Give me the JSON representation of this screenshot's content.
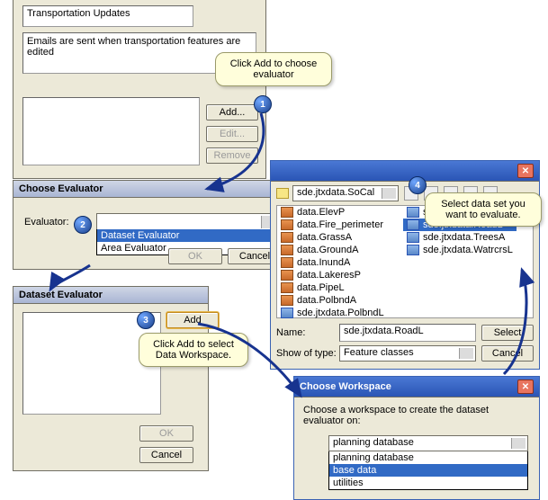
{
  "top": {
    "title": "Transportation Updates",
    "note": "Emails are sent when transportation features are edited",
    "add": "Add...",
    "edit": "Edit...",
    "remove": "Remove"
  },
  "chooseEval": {
    "title": "Choose Evaluator",
    "label": "Evaluator:",
    "options": [
      "Dataset Evaluator",
      "Area Evaluator"
    ],
    "ok": "OK",
    "cancel": "Cancel"
  },
  "dsEval": {
    "title": "Dataset Evaluator",
    "add": "Add",
    "ok": "OK",
    "cancel": "Cancel"
  },
  "browser": {
    "path": "sde.jtxdata.SoCal",
    "left": [
      "data.ElevP",
      "data.Fire_perimeter",
      "data.GrassA",
      "data.GroundA",
      "data.InundA",
      "data.LakeresP",
      "data.PipeL",
      "data.PolbndA",
      "sde.jtxdata.PolbndL"
    ],
    "right": [
      "sde.jtxdata.RailrdL",
      "sde.jtxdata.RoadL",
      "sde.jtxdata.TreesA",
      "sde.jtxdata.WatrcrsL"
    ],
    "nameLbl": "Name:",
    "nameVal": "sde.jtxdata.RoadL",
    "showLbl": "Show of type:",
    "showVal": "Feature classes",
    "select": "Select",
    "cancel": "Cancel"
  },
  "ws": {
    "title": "Choose Workspace",
    "prompt": "Choose a workspace to create the dataset evaluator on:",
    "value": "planning database",
    "options": [
      "planning database",
      "base data",
      "utilities"
    ]
  },
  "callouts": {
    "c1": "Click Add to choose evaluator",
    "c3": "Click Add to select Data Workspace.",
    "c4": "Select data set you want to evaluate."
  }
}
